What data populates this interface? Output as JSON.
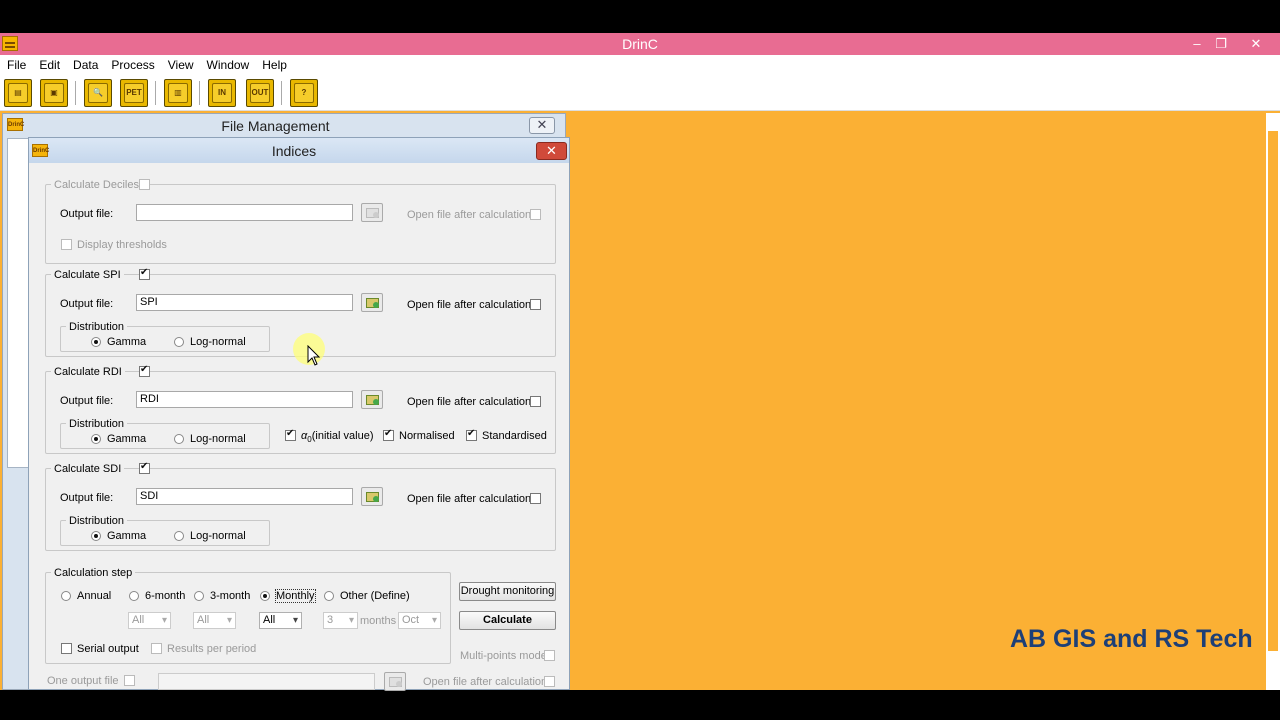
{
  "app": {
    "title": "DrinC",
    "window_controls": {
      "minimize": "–",
      "restore": "❐",
      "close": "✕"
    }
  },
  "menu": [
    "File",
    "Edit",
    "Data",
    "Process",
    "View",
    "Window",
    "Help"
  ],
  "toolbar": {
    "buttons": [
      {
        "name": "open-folder",
        "glyph": "▤"
      },
      {
        "name": "save",
        "glyph": "▣"
      },
      {
        "name": "search",
        "glyph": "🔍"
      },
      {
        "name": "pet",
        "glyph": "PET"
      },
      {
        "name": "chart",
        "glyph": "▥"
      },
      {
        "name": "input-table",
        "glyph": "IN"
      },
      {
        "name": "output-table",
        "glyph": "OUT"
      },
      {
        "name": "help",
        "glyph": "?"
      }
    ]
  },
  "file_management": {
    "title": "File Management",
    "close": "✕",
    "icon_text": "DrinC"
  },
  "indices": {
    "title": "Indices",
    "icon_text": "DrinC",
    "close": "✕",
    "deciles": {
      "label": "Calculate Deciles",
      "checked": false,
      "output_label": "Output file:",
      "output_value": "",
      "open_after": "Open file after calculation",
      "display_thresholds": "Display thresholds"
    },
    "spi": {
      "label": "Calculate SPI",
      "checked": true,
      "output_label": "Output file:",
      "output_value": "SPI",
      "open_after": "Open file after calculation",
      "distribution_label": "Distribution",
      "gamma": "Gamma",
      "lognormal": "Log-normal",
      "selected": "Gamma"
    },
    "rdi": {
      "label": "Calculate RDI",
      "checked": true,
      "output_label": "Output file:",
      "output_value": "RDI",
      "open_after": "Open file after calculation",
      "distribution_label": "Distribution",
      "gamma": "Gamma",
      "lognormal": "Log-normal",
      "alpha_symbol": "α",
      "alpha_sub": "0",
      "alpha_label": "(initial value)",
      "normalised": "Normalised",
      "standardised": "Standardised"
    },
    "sdi": {
      "label": "Calculate SDI",
      "checked": true,
      "output_label": "Output file:",
      "output_value": "SDI",
      "open_after": "Open file after calculation",
      "distribution_label": "Distribution",
      "gamma": "Gamma",
      "lognormal": "Log-normal"
    },
    "calc_step": {
      "label": "Calculation step",
      "options": [
        "Annual",
        "6-month",
        "3-month",
        "Monthly",
        "Other (Define)"
      ],
      "selected": "Monthly",
      "combo_6month": "All",
      "combo_3month": "All",
      "combo_monthly": "All",
      "combo_other_months": "3",
      "months_label": "months",
      "combo_other_start": "Oct",
      "serial_output": "Serial output",
      "results_per_period": "Results per period"
    },
    "drought_monitoring": "Drought monitoring",
    "calculate": "Calculate",
    "multi_points": "Multi-points mode",
    "one_output_file": "One output file",
    "open_after_bottom": "Open file after calculation"
  },
  "watermark": "AB GIS and RS Tech",
  "colors": {
    "titlebar": "#e86c92",
    "background": "#fbb034",
    "watermark": "#1d3f77",
    "close_red": "#d04a3a"
  }
}
